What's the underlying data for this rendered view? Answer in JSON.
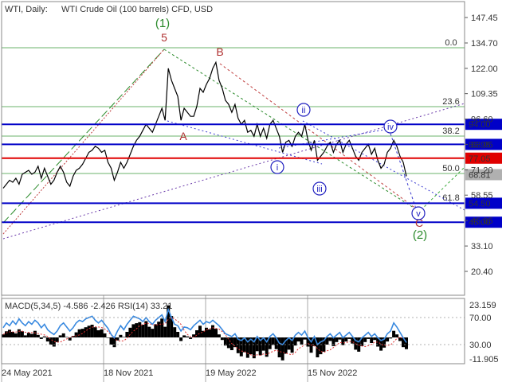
{
  "header": {
    "instrument": "WTI, Daily:",
    "description": "WTI Crude Oil (100 barrels) CFD, USD"
  },
  "chart_data": [
    {
      "type": "line",
      "title": "WTI, Daily:  WTI Crude Oil (100 barrels) CFD, USD",
      "y_axis_ticks": [
        "147.45",
        "134.70",
        "122.00",
        "109.35",
        "96.60",
        "83.95",
        "71.20",
        "58.55",
        "45.85",
        "33.10",
        "20.40"
      ],
      "x_axis_ticks": [
        "24 May 2021",
        "18 Nov 2021",
        "19 May 2022",
        "15 Nov 2022"
      ],
      "ylim": [
        14,
        154
      ],
      "series": [
        {
          "values": [
            62,
            64,
            66,
            65,
            67,
            64,
            69,
            70,
            71,
            69,
            70,
            73,
            67,
            72,
            68,
            64,
            66,
            70,
            73,
            70,
            65,
            63,
            68,
            71,
            72,
            74,
            77,
            80,
            81,
            83,
            82,
            80,
            81,
            75,
            72,
            66,
            70,
            75,
            72,
            75,
            79,
            83,
            86,
            88,
            91,
            94,
            92,
            90,
            94,
            98,
            102,
            96,
            122,
            116,
            112,
            108,
            96,
            102,
            100,
            98,
            98,
            103,
            112,
            110,
            114,
            117,
            122,
            125,
            116,
            112,
            106,
            104,
            100,
            104,
            97,
            94,
            96,
            90,
            91,
            88,
            94,
            88,
            92,
            87,
            94,
            96,
            92,
            88,
            80,
            85,
            86,
            83,
            88,
            90,
            88,
            94,
            86,
            81,
            86,
            76,
            78,
            80,
            83,
            85,
            80,
            84,
            86,
            80,
            84,
            86,
            82,
            78,
            76,
            80,
            82,
            84,
            79,
            82,
            76,
            72,
            74,
            80,
            82,
            86,
            83,
            78,
            75,
            68
          ]
        }
      ],
      "horizontal_levels": [
        {
          "label": "94.00",
          "color": "#0000c8"
        },
        {
          "label": "83.95",
          "color": "#0000c8"
        },
        {
          "label": "77.05",
          "color": "#e00000"
        },
        {
          "label": "68.81",
          "color": "#b0b0b0"
        },
        {
          "label": "54.50",
          "color": "#0000c8"
        },
        {
          "label": "45.00",
          "color": "#0000c8"
        }
      ],
      "fibonacci_levels": [
        "0.0",
        "23.6",
        "38.2",
        "50.0",
        "61.8"
      ],
      "wave_labels": {
        "primary": [
          "(1)",
          "(2)"
        ],
        "minor": [
          "5",
          "A",
          "B",
          "C"
        ],
        "circled": [
          "i",
          "ii",
          "iii",
          "iv",
          "v"
        ]
      }
    },
    {
      "type": "line",
      "title": "MACD(5,34,5) -4.586 -2.426 RSI(14) 33.21",
      "indicator_names": [
        "MACD(5,34,5)",
        "RSI(14)"
      ],
      "indicator_values": [
        "-4.586",
        "-2.426",
        "33.21"
      ],
      "y_axis_ticks": [
        "23.159",
        "70.00",
        "30.00",
        "-11.905"
      ],
      "series": [
        {
          "values": [
            55,
            62,
            58,
            65,
            60,
            68,
            62,
            58,
            64,
            60,
            66,
            62,
            55,
            60,
            52,
            48,
            45,
            50,
            58,
            62,
            56,
            50,
            55,
            62,
            66,
            64,
            68,
            70,
            72,
            66,
            62,
            66,
            60,
            54,
            45,
            40,
            50,
            58,
            52,
            60,
            66,
            72,
            70,
            68,
            64,
            70,
            64,
            60,
            66,
            70,
            74,
            64,
            82,
            70,
            60,
            58,
            50,
            56,
            55,
            52,
            58,
            62,
            66,
            60,
            64,
            62,
            66,
            62,
            58,
            52,
            46,
            44,
            42,
            46,
            38,
            36,
            40,
            34,
            38,
            34,
            42,
            36,
            40,
            34,
            42,
            46,
            40,
            32,
            30,
            36,
            40,
            36,
            44,
            48,
            44,
            50,
            40,
            34,
            42,
            30,
            34,
            36,
            42,
            46,
            40,
            44,
            48,
            40,
            44,
            48,
            42,
            36,
            34,
            40,
            44,
            48,
            42,
            46,
            40,
            36,
            38,
            46,
            50,
            62,
            56,
            48,
            40,
            33
          ]
        },
        {
          "values": [
            1.2,
            2.4,
            3.0,
            2.2,
            1.6,
            3.2,
            2.4,
            0.8,
            1.8,
            1.4,
            2.6,
            1.0,
            -0.6,
            0.4,
            -1.6,
            -2.8,
            -3.6,
            -1.8,
            0.8,
            1.6,
            0.2,
            -1.2,
            0.6,
            2.0,
            3.2,
            3.4,
            4.0,
            4.6,
            5.0,
            4.0,
            2.8,
            3.2,
            1.6,
            -0.2,
            -2.8,
            -3.8,
            -1.2,
            1.0,
            0.2,
            2.2,
            3.8,
            5.2,
            5.6,
            6.0,
            5.0,
            6.4,
            4.2,
            3.4,
            5.2,
            6.2,
            7.4,
            4.2,
            12.6,
            8.4,
            4.0,
            2.2,
            -1.4,
            0.8,
            0.4,
            -0.6,
            1.2,
            2.8,
            4.6,
            2.6,
            3.8,
            3.2,
            4.8,
            3.4,
            1.2,
            -1.0,
            -3.2,
            -4.2,
            -5.0,
            -3.8,
            -6.2,
            -7.4,
            -5.8,
            -8.0,
            -6.6,
            -8.2,
            -5.4,
            -7.0,
            -5.2,
            -7.6,
            -4.6,
            -3.0,
            -4.6,
            -7.8,
            -9.0,
            -6.4,
            -4.8,
            -6.0,
            -3.2,
            -1.6,
            -2.8,
            -0.8,
            -3.6,
            -6.0,
            -3.4,
            -7.8,
            -6.6,
            -5.6,
            -2.8,
            -1.4,
            -3.4,
            -1.8,
            -0.8,
            -3.0,
            -1.6,
            -0.6,
            -2.4,
            -4.8,
            -5.6,
            -3.4,
            -1.8,
            -0.6,
            -2.2,
            -1.0,
            -3.6,
            -5.2,
            -4.0,
            -1.6,
            -0.4,
            2.6,
            1.2,
            -1.4,
            -3.8,
            -4.6
          ]
        }
      ]
    }
  ]
}
